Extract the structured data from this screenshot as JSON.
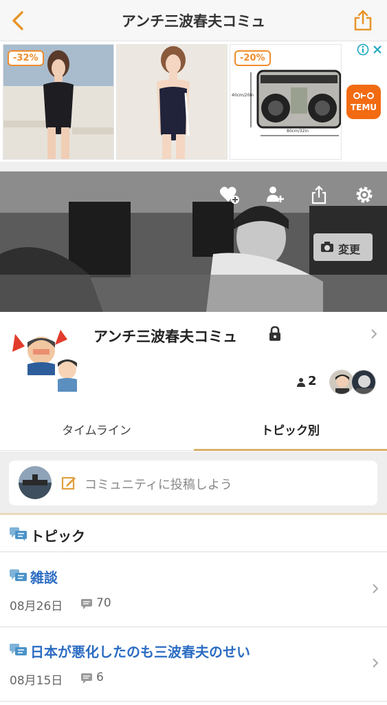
{
  "header": {
    "title": "アンチ三波春夫コミュ",
    "accent_color": "#e8952b"
  },
  "ad": {
    "discount_1": "-32%",
    "discount_2": "-20%",
    "radio_dims_left": "40cm/20in",
    "radio_dims_bottom": "80cm/32in",
    "brand": "TEMU"
  },
  "cover": {
    "change_label": "変更"
  },
  "profile": {
    "name": "アンチ三波春夫コミュ",
    "member_count": "2"
  },
  "tabs": [
    {
      "label": "タイムライン",
      "active": false
    },
    {
      "label": "トピック別",
      "active": true
    }
  ],
  "post": {
    "placeholder": "コミュニティに投稿しよう"
  },
  "topics": {
    "title": "トピック",
    "items": [
      {
        "title": "雑談",
        "date": "08月26日",
        "count": "70"
      },
      {
        "title": "日本が悪化したのも三波春夫のせい",
        "date": "08月15日",
        "count": "6"
      }
    ]
  }
}
